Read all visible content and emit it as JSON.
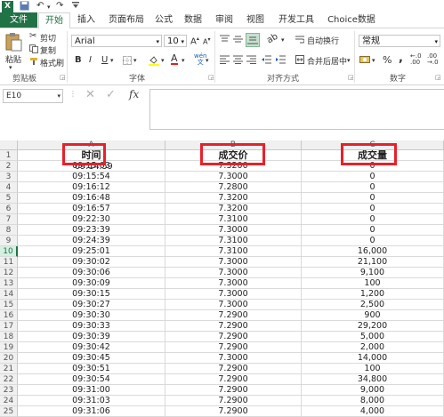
{
  "ribbon_tabs": [
    "文件",
    "开始",
    "插入",
    "页面布局",
    "公式",
    "数据",
    "审阅",
    "视图",
    "开发工具",
    "Choice数据"
  ],
  "clipboard": {
    "cut": "剪切",
    "copy": "复制",
    "format_painter": "格式刷",
    "paste": "粘贴",
    "group": "剪贴板"
  },
  "font": {
    "family": "Arial",
    "size": "10",
    "group": "字体",
    "wen": "wén"
  },
  "alignment": {
    "wrap": "自动换行",
    "merge": "合并后居中",
    "group": "对齐方式"
  },
  "number": {
    "format": "常规",
    "group": "数字",
    "percent": "%",
    "comma": ","
  },
  "formula_bar": {
    "name_box": "E10",
    "fx": "fx"
  },
  "columns": [
    "A",
    "B",
    "C"
  ],
  "headers": [
    "时间",
    "成交价",
    "成交量"
  ],
  "rows": [
    {
      "n": "1",
      "time": "",
      "price": "",
      "vol": ""
    },
    {
      "n": "2",
      "time": "09:15:03",
      "price": "7.3200",
      "vol": "0"
    },
    {
      "n": "3",
      "time": "09:15:54",
      "price": "7.3000",
      "vol": "0"
    },
    {
      "n": "4",
      "time": "09:16:12",
      "price": "7.2800",
      "vol": "0"
    },
    {
      "n": "5",
      "time": "09:16:48",
      "price": "7.3200",
      "vol": "0"
    },
    {
      "n": "6",
      "time": "09:16:57",
      "price": "7.3200",
      "vol": "0"
    },
    {
      "n": "7",
      "time": "09:22:30",
      "price": "7.3100",
      "vol": "0"
    },
    {
      "n": "8",
      "time": "09:23:39",
      "price": "7.3000",
      "vol": "0"
    },
    {
      "n": "9",
      "time": "09:24:39",
      "price": "7.3100",
      "vol": "0"
    },
    {
      "n": "10",
      "time": "09:25:01",
      "price": "7.3100",
      "vol": "16,000"
    },
    {
      "n": "11",
      "time": "09:30:02",
      "price": "7.3000",
      "vol": "21,100"
    },
    {
      "n": "12",
      "time": "09:30:06",
      "price": "7.3000",
      "vol": "9,100"
    },
    {
      "n": "13",
      "time": "09:30:09",
      "price": "7.3000",
      "vol": "100"
    },
    {
      "n": "14",
      "time": "09:30:15",
      "price": "7.3000",
      "vol": "1,200"
    },
    {
      "n": "15",
      "time": "09:30:27",
      "price": "7.3000",
      "vol": "2,500"
    },
    {
      "n": "16",
      "time": "09:30:30",
      "price": "7.2900",
      "vol": "900"
    },
    {
      "n": "17",
      "time": "09:30:33",
      "price": "7.2900",
      "vol": "29,200"
    },
    {
      "n": "18",
      "time": "09:30:39",
      "price": "7.2900",
      "vol": "5,000"
    },
    {
      "n": "19",
      "time": "09:30:42",
      "price": "7.2900",
      "vol": "2,000"
    },
    {
      "n": "20",
      "time": "09:30:45",
      "price": "7.3000",
      "vol": "14,000"
    },
    {
      "n": "21",
      "time": "09:30:51",
      "price": "7.2900",
      "vol": "100"
    },
    {
      "n": "22",
      "time": "09:30:54",
      "price": "7.2900",
      "vol": "34,800"
    },
    {
      "n": "23",
      "time": "09:31:00",
      "price": "7.2900",
      "vol": "9,000"
    },
    {
      "n": "24",
      "time": "09:31:03",
      "price": "7.2900",
      "vol": "8,000"
    },
    {
      "n": "25",
      "time": "09:31:06",
      "price": "7.2900",
      "vol": "4,000"
    }
  ],
  "partial_values": {
    "row1_time": "09:14:59"
  },
  "colors": {
    "excel_green": "#217346",
    "highlight_red": "#e8202a"
  }
}
